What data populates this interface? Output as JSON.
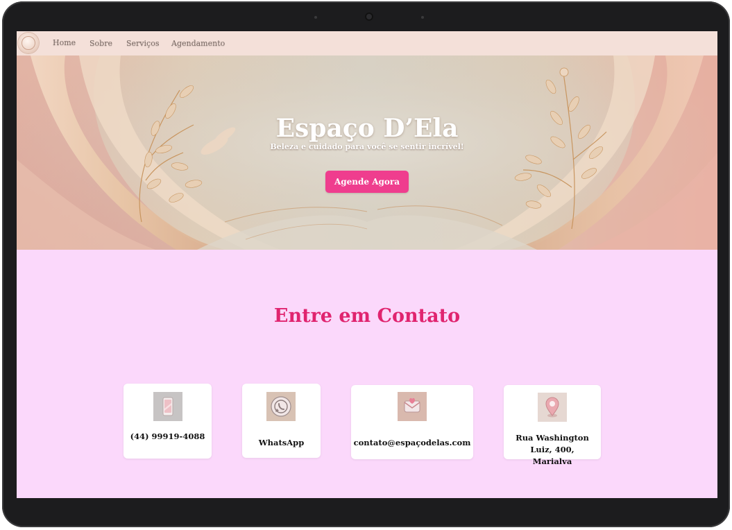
{
  "nav": {
    "items": [
      {
        "label": "Home"
      },
      {
        "label": "Sobre"
      },
      {
        "label": "Serviços"
      },
      {
        "label": "Agendamento"
      }
    ]
  },
  "hero": {
    "title": "Espaço D’Ela",
    "subtitle": "Beleza e cuidado para você se sentir incrível!",
    "cta_label": "Agende Agora"
  },
  "contact": {
    "title": "Entre em Contato",
    "cards": [
      {
        "icon": "phone-icon",
        "label": "(44) 99919-4088"
      },
      {
        "icon": "whatsapp-icon",
        "label": "WhatsApp"
      },
      {
        "icon": "email-icon",
        "label": "contato@espaçodelas.com"
      },
      {
        "icon": "location-pin-icon",
        "label": "Rua Washington Luiz, 400, Marialva"
      }
    ]
  },
  "colors": {
    "accent": "#ef3d8e",
    "heading": "#e0246f",
    "page_background": "#fbd8fb",
    "nav_background": "#f4e0d9"
  }
}
